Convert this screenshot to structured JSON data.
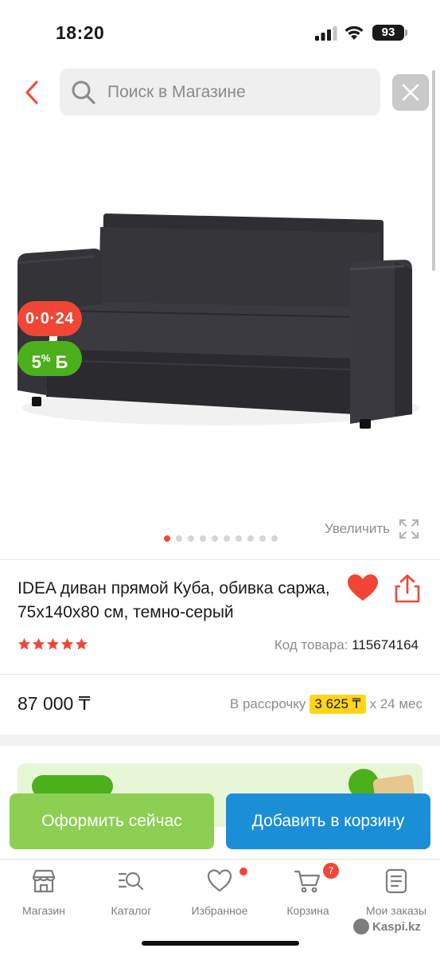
{
  "status_bar": {
    "time": "18:20",
    "battery": "93"
  },
  "search": {
    "placeholder": "Поиск в Магазине"
  },
  "product": {
    "badges": {
      "installment": "0·0·24",
      "bonus_percent": "5",
      "bonus_sup": "%",
      "bonus_symbol": "Б"
    },
    "gallery": {
      "total_images": 10,
      "active_index": 0,
      "zoom_label": "Увеличить"
    },
    "title": "IDEA диван прямой Куба, обивка саржа, 75x140x80 см, темно-серый",
    "rating_stars": 5,
    "sku_label": "Код товара:",
    "sku_value": "115674164",
    "price": "87 000 ₸",
    "installment": {
      "prefix": "В рассрочку",
      "amount": "3 625 ₸",
      "suffix": "х 24 мес"
    }
  },
  "actions": {
    "buy_now": "Оформить сейчас",
    "add_to_cart": "Добавить в корзину"
  },
  "bottom_nav": {
    "items": [
      {
        "label": "Магазин",
        "icon": "store-icon"
      },
      {
        "label": "Каталог",
        "icon": "catalog-search-icon"
      },
      {
        "label": "Избранное",
        "icon": "heart-outline-icon"
      },
      {
        "label": "Корзина",
        "icon": "cart-icon"
      },
      {
        "label": "Мои заказы",
        "icon": "orders-icon"
      }
    ],
    "cart_count": "7"
  },
  "watermark": "Kaspi.kz",
  "colors": {
    "accent_red": "#f14635",
    "green": "#4caf1c",
    "buy_green": "#8ccf52",
    "cart_blue": "#1a8fd8",
    "highlight_yellow": "#ffd51a"
  }
}
